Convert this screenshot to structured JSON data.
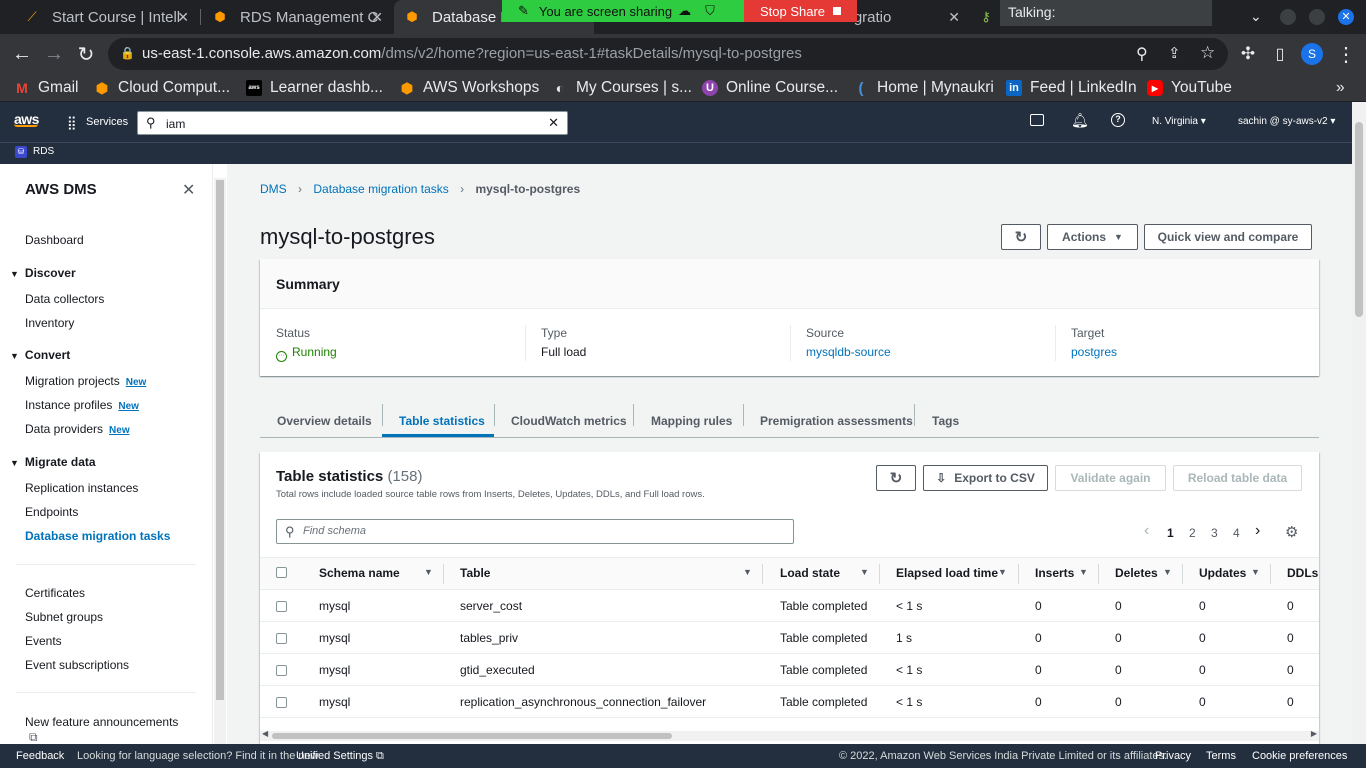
{
  "browser": {
    "tabs": [
      {
        "title": "Start Course | Intell",
        "icon": "intellipaat-icon"
      },
      {
        "title": "RDS Management C",
        "icon": "aws-icon"
      },
      {
        "title": "Database Mi",
        "icon": "aws-icon",
        "active": true
      },
      {
        "title": "se Migratio",
        "icon": "aws-icon"
      },
      {
        "title": "",
        "icon": "key-icon"
      }
    ],
    "screen_share": {
      "message": "You are screen sharing",
      "stop_label": "Stop Share"
    },
    "talking_label": "Talking:",
    "url_host": "us-east-1.console.aws.amazon.com",
    "url_path": "/dms/v2/home?region=us-east-1#taskDetails/mysql-to-postgres",
    "profile_initial": "S",
    "bookmarks": [
      {
        "label": "Gmail",
        "color": "#ea4335",
        "glyph": "M"
      },
      {
        "label": "Cloud Comput...",
        "color": "#ff9900",
        "glyph": "◆"
      },
      {
        "label": "Learner dashb...",
        "color": "#000000",
        "glyph": "aws"
      },
      {
        "label": "AWS Workshops",
        "color": "#ff9900",
        "glyph": "◆"
      },
      {
        "label": "My Courses | s...",
        "color": "#5f6368",
        "glyph": "◐"
      },
      {
        "label": "Online Course...",
        "color": "#8e44ad",
        "glyph": "U"
      },
      {
        "label": "Home | Mynaukri",
        "color": "#4a90d9",
        "glyph": "("
      },
      {
        "label": "Feed | LinkedIn",
        "color": "#0a66c2",
        "glyph": "in"
      },
      {
        "label": "YouTube",
        "color": "#ff0000",
        "glyph": "▶"
      }
    ]
  },
  "aws_header": {
    "services_label": "Services",
    "search_value": "iam",
    "region": "N. Virginia",
    "account": "sachin @ sy-aws-v2",
    "favorite": "RDS"
  },
  "sidebar": {
    "title": "AWS DMS",
    "dashboard": "Dashboard",
    "sections": [
      {
        "heading": "Discover",
        "items": [
          {
            "label": "Data collectors"
          },
          {
            "label": "Inventory"
          }
        ]
      },
      {
        "heading": "Convert",
        "items": [
          {
            "label": "Migration projects",
            "badge": "New"
          },
          {
            "label": "Instance profiles",
            "badge": "New"
          },
          {
            "label": "Data providers",
            "badge": "New"
          }
        ]
      },
      {
        "heading": "Migrate data",
        "items": [
          {
            "label": "Replication instances"
          },
          {
            "label": "Endpoints"
          },
          {
            "label": "Database migration tasks",
            "active": true
          }
        ]
      }
    ],
    "extra": [
      "Certificates",
      "Subnet groups",
      "Events",
      "Event subscriptions"
    ],
    "announcements": "New feature announcements"
  },
  "breadcrumb": [
    "DMS",
    "Database migration tasks",
    "mysql-to-postgres"
  ],
  "page_title": "mysql-to-postgres",
  "header_buttons": {
    "actions": "Actions",
    "quick_view": "Quick view and compare"
  },
  "summary": {
    "title": "Summary",
    "status_label": "Status",
    "status_value": "Running",
    "type_label": "Type",
    "type_value": "Full load",
    "source_label": "Source",
    "source_value": "mysqldb-source",
    "target_label": "Target",
    "target_value": "postgres"
  },
  "tabs": [
    "Overview details",
    "Table statistics",
    "CloudWatch metrics",
    "Mapping rules",
    "Premigration assessments",
    "Tags"
  ],
  "active_tab": "Table statistics",
  "table_stats": {
    "title": "Table statistics",
    "count": "(158)",
    "description": "Total rows include loaded source table rows from Inserts, Deletes, Updates, DDLs, and Full load rows.",
    "export_label": "Export to CSV",
    "validate_label": "Validate again",
    "reload_label": "Reload table data",
    "search_placeholder": "Find schema",
    "pages": [
      "1",
      "2",
      "3",
      "4"
    ],
    "current_page": "1",
    "columns": [
      "Schema name",
      "Table",
      "Load state",
      "Elapsed load time",
      "Inserts",
      "Deletes",
      "Updates",
      "DDLs"
    ],
    "rows": [
      [
        "mysql",
        "server_cost",
        "Table completed",
        "< 1 s",
        "0",
        "0",
        "0",
        "0"
      ],
      [
        "mysql",
        "tables_priv",
        "Table completed",
        "1 s",
        "0",
        "0",
        "0",
        "0"
      ],
      [
        "mysql",
        "gtid_executed",
        "Table completed",
        "< 1 s",
        "0",
        "0",
        "0",
        "0"
      ],
      [
        "mysql",
        "replication_asynchronous_connection_failover",
        "Table completed",
        "< 1 s",
        "0",
        "0",
        "0",
        "0"
      ]
    ]
  },
  "footer": {
    "feedback": "Feedback",
    "language_note": "Looking for language selection? Find it in the new",
    "unified_settings": "Unified Settings",
    "copyright": "© 2022, Amazon Web Services India Private Limited or its affiliates.",
    "privacy": "Privacy",
    "terms": "Terms",
    "cookie": "Cookie preferences"
  },
  "colors": {
    "aws_nav": "#232f3e",
    "link": "#0073bb",
    "success": "#1d8102",
    "share_green": "#2ecc40",
    "share_red": "#e53935"
  }
}
